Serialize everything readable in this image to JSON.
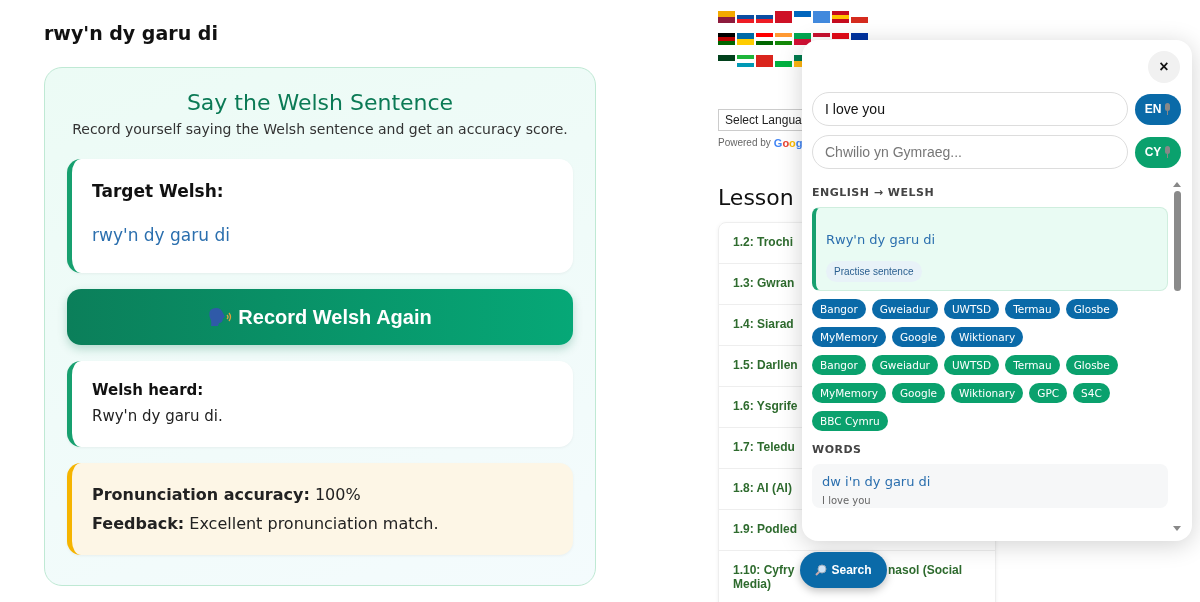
{
  "page_title": "rwy'n dy garu di",
  "practice": {
    "heading": "Say the Welsh Sentence",
    "subtitle": "Record yourself saying the Welsh sentence and get an accuracy score.",
    "target_label": "Target Welsh:",
    "target_text": "rwy'n dy garu di",
    "record_button": "Record Welsh Again",
    "heard_label": "Welsh heard:",
    "heard_text": "Rwy'n dy garu di.",
    "result_lines": [
      "**Pronunciation accuracy:** 100%",
      "**Feedback:** Excellent pronunciation match."
    ]
  },
  "translate": {
    "select": "Select Langua",
    "powered_by": "Powered by",
    "logo": "Goog"
  },
  "lessons": {
    "heading": "Lesson",
    "items": [
      {
        "lines": [
          "1.2: Trochi"
        ]
      },
      {
        "lines": [
          "1.3: Gwran"
        ]
      },
      {
        "lines": [
          "1.4: Siarad"
        ]
      },
      {
        "lines": [
          "1.5: Darllen"
        ]
      },
      {
        "lines": [
          "1.6: Ysgrife"
        ]
      },
      {
        "lines": [
          "1.7: Teledu"
        ]
      },
      {
        "lines": [
          "1.8: AI (AI)"
        ]
      },
      {
        "lines": [
          "1.9: Podled"
        ]
      },
      {
        "lines": [
          "1.10: Cyfry",
          "nasol (Social",
          "Media)"
        ]
      }
    ]
  },
  "search_popup": {
    "close": "×",
    "fields": [
      {
        "kind": "english",
        "value": "I love you",
        "button": "EN"
      },
      {
        "kind": "welsh",
        "placeholder": "Chwilio yn Gymraeg...",
        "button": "CY"
      }
    ],
    "section_heading": "ENGLISH → WELSH",
    "result": {
      "text": "Rwy'n dy garu di",
      "action": "Practise sentence"
    },
    "source_groups": [
      {
        "kind": "english",
        "links": [
          "Bangor",
          "Gweiadur",
          "UWTSD",
          "Termau",
          "Glosbe",
          "MyMemory",
          "Google",
          "Wiktionary"
        ]
      },
      {
        "kind": "welsh",
        "links": [
          "Bangor",
          "Gweiadur",
          "UWTSD",
          "Termau",
          "Glosbe",
          "MyMemory",
          "Google",
          "Wiktionary",
          "GPC",
          "S4C",
          "BBC Cymru"
        ]
      }
    ],
    "words_heading": "WORDS",
    "words": [
      {
        "welsh": "dw i'n dy garu di",
        "english": "I love you"
      }
    ]
  },
  "search_button": "Search"
}
